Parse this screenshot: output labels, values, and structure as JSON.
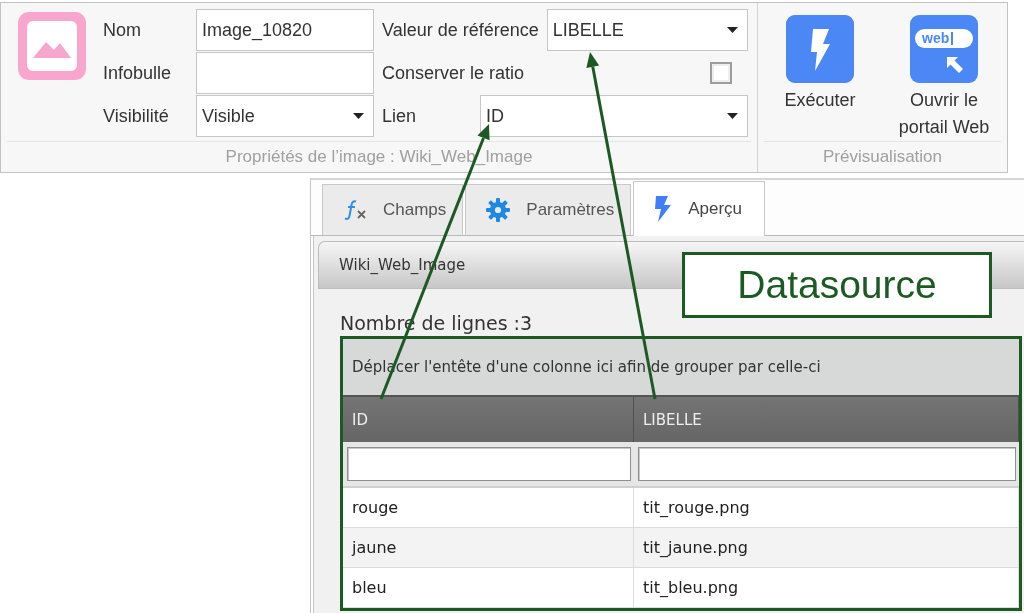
{
  "ribbon": {
    "properties": {
      "fields": [
        {
          "kind": "text",
          "label": "Nom",
          "value": "Image_10820"
        },
        {
          "kind": "dropdown",
          "label": "Valeur de référence",
          "value": "LIBELLE"
        },
        {
          "kind": "text",
          "label": "Infobulle"
        },
        {
          "kind": "checkbox",
          "label": "Conserver le ratio",
          "checked": false
        },
        {
          "kind": "dropdown",
          "label": "Visibilité",
          "value": "Visible"
        },
        {
          "kind": "dropdown",
          "label": "Lien",
          "value": "ID"
        }
      ],
      "title": "Propriétés de l’image : Wiki_Web_Image"
    },
    "preview": {
      "buttons": [
        {
          "kind": "run",
          "label": "Exécuter"
        },
        {
          "kind": "web",
          "label": "Ouvrir le portail Web",
          "icon_text": "web"
        }
      ],
      "title": "Prévisualisation"
    }
  },
  "tabs": [
    {
      "kind": "formula",
      "label": "Champs",
      "selected": false
    },
    {
      "kind": "gear",
      "label": "Paramètres",
      "selected": false
    },
    {
      "kind": "bolt",
      "label": "Aperçu",
      "selected": true
    }
  ],
  "panel": {
    "title": "Wiki_Web_Image",
    "row_count": "Nombre de lignes :3",
    "grid": {
      "group_hint": "Déplacer l'entête d'une colonne ici afin de grouper par celle-ci",
      "columns": [
        "ID",
        "LIBELLE"
      ],
      "rows": [
        [
          "rouge",
          "tit_rouge.png"
        ],
        [
          "jaune",
          "tit_jaune.png"
        ],
        [
          "bleu",
          "tit_bleu.png"
        ]
      ]
    }
  },
  "annotation": {
    "label": "Datasource"
  }
}
